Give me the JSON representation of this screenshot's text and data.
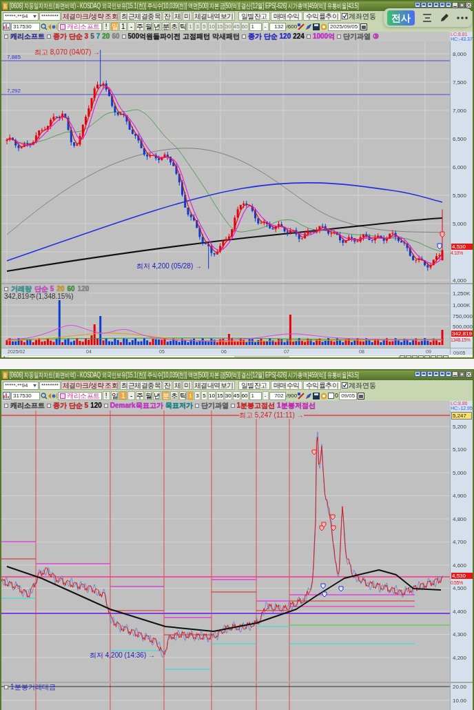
{
  "floating_toolbar": {
    "button": "전사"
  },
  "windows": [
    {
      "kind": "daily",
      "title": "[0606] 자동일자차트(화면비역) - KOSDAQ 외국인보유[15.1(천)] 주식수[10,039(천)] 액면[500] 자본금[50(억)] 결산[12월] EPS[-626] 시가총액[459(억)] 유통비율[43.5]",
      "account": {
        "number": "*****-**94",
        "password": "********",
        "buttons": [
          {
            "label": "체결마크/생략 조회",
            "kind": "mark"
          },
          {
            "label": "최근체결종목",
            "kind": "plain"
          },
          {
            "label": "잔",
            "kind": "plain"
          },
          {
            "label": "체",
            "kind": "plain"
          },
          {
            "label": "미",
            "kind": "plain"
          },
          {
            "label": "체결내역보기",
            "kind": "plain"
          },
          {
            "label": "일별잔고",
            "kind": "wide"
          },
          {
            "label": "매매수익",
            "kind": "wide"
          },
          {
            "label": "수익률추이",
            "kind": "wide"
          }
        ],
        "checkbox": {
          "label": "계좌연동",
          "checked": true
        }
      },
      "symbol": {
        "code": "317530",
        "name": "캐리소프트",
        "alert": "!",
        "periods": [
          {
            "label": "일",
            "selected": true
          },
          {
            "label": "1",
            "selected": false
          },
          {
            "label": "-",
            "selected": false
          },
          {
            "label": "주",
            "selected": false
          },
          {
            "label": "월",
            "selected": false
          },
          {
            "label": "년",
            "selected": false
          },
          {
            "label": "분",
            "selected": false
          },
          {
            "label": "초",
            "selected": false
          },
          {
            "label": "틱",
            "selected": false
          }
        ],
        "intervals": [
          {
            "label": "1",
            "selected": false,
            "disabled": true
          },
          {
            "label": "3",
            "selected": false,
            "disabled": true
          },
          {
            "label": "5",
            "selected": false,
            "disabled": true
          },
          {
            "label": "10",
            "selected": false,
            "disabled": true
          },
          {
            "label": "15",
            "selected": false,
            "disabled": true
          },
          {
            "label": "30",
            "selected": false,
            "disabled": true
          },
          {
            "label": "45",
            "selected": false,
            "disabled": true
          },
          {
            "label": "60",
            "selected": false,
            "disabled": true
          }
        ],
        "count": "1",
        "count_button": "-",
        "shown": "132",
        "total": "/600",
        "date": "2025/09/05"
      },
      "chart": {
        "legend": [
          {
            "items": [
              {
                "text": "캐리소프트",
                "color": "#2a2a9a"
              }
            ]
          },
          {
            "items": [
              {
                "text": "종가 단순 3",
                "color": "#e02020"
              },
              {
                "text": "5",
                "color": "#5c5c5c"
              },
              {
                "text": "7",
                "color": "#00a0a0"
              },
              {
                "text": "20",
                "color": "#30a030"
              },
              {
                "text": "60",
                "color": "#8a8a8a"
              }
            ]
          },
          {
            "items": [
              {
                "text": "500억원돌파이전 고점패턴",
                "color": "#202020"
              },
              {
                "text": "막새패턴",
                "color": "#303030"
              }
            ]
          },
          {
            "items": [
              {
                "text": "종가 단순 120",
                "color": "#2020e0"
              },
              {
                "text": "224",
                "color": "#101010"
              }
            ]
          },
          {
            "items": [
              {
                "text": "1000억",
                "color": "#e020e0"
              }
            ]
          },
          {
            "items": [
              {
                "text": "단기과열",
                "color": "#606060"
              },
              {
                "text": "③",
                "color": "#d020d0"
              }
            ]
          }
        ],
        "lc": "LC:8.81",
        "hc": "HC:-43.37",
        "ticks": [
          "8,000",
          "7,500",
          "7,000",
          "6,500",
          "6,000",
          "5,500",
          "5,000",
          "4,000"
        ],
        "tags": [
          {
            "text": "4,530",
            "kind": "price"
          },
          {
            "text": "4.10%",
            "kind": "change"
          }
        ],
        "annotations": [
          {
            "text": "7,885",
            "kind": "level"
          },
          {
            "text": "7,292",
            "kind": "level"
          },
          {
            "text": "최고 8,070 (04/07) →",
            "kind": "high"
          },
          {
            "text": "최저 4,200 (05/28) →",
            "kind": "low"
          }
        ]
      },
      "volume": {
        "legend": [
          {
            "text": "거래량",
            "color": "#20a0a0"
          },
          {
            "text": "단순 5",
            "color": "#e040e0"
          },
          {
            "text": "20",
            "color": "#e0a000"
          },
          {
            "text": "60",
            "color": "#30a030"
          },
          {
            "text": "120",
            "color": "#8a8a8a"
          }
        ],
        "info": "342,819주(1,348.15%)",
        "ticks": [
          "1,250K",
          "1,000K",
          "750,000",
          "500,000"
        ],
        "tags": [
          {
            "text": "342,819",
            "kind": "price"
          },
          {
            "text": "1348.15%",
            "kind": "change"
          }
        ]
      },
      "x_axis": {
        "labels": [
          "2025/02",
          "04",
          "05",
          "06",
          "07",
          "08",
          "09"
        ],
        "end": "09/05"
      }
    },
    {
      "kind": "minute",
      "title": "[0606] 자동일자차트(화면비역) - KOSDAQ 외국인보유[15.1(천)] 주식수[10,039(천)] 액면[500] 자본금[50(억)] 결산[12월] EPS[-626] 시가총액[459(억)] 유통비율[43.5]",
      "account": {
        "number": "*****-**94",
        "password": "********",
        "buttons": [
          {
            "label": "체결마크/생략 조회",
            "kind": "mark"
          },
          {
            "label": "최근체결종목",
            "kind": "plain"
          },
          {
            "label": "잔",
            "kind": "plain"
          },
          {
            "label": "체",
            "kind": "plain"
          },
          {
            "label": "미",
            "kind": "plain"
          },
          {
            "label": "체결내역보기",
            "kind": "plain"
          },
          {
            "label": "일별잔고",
            "kind": "wide"
          },
          {
            "label": "매매수익",
            "kind": "wide"
          },
          {
            "label": "수익률추이",
            "kind": "wide"
          }
        ],
        "checkbox": {
          "label": "계좌연동",
          "checked": true
        }
      },
      "symbol": {
        "code": "317530",
        "name": "캐리소프트",
        "alert": "!",
        "periods": [
          {
            "label": "일",
            "selected": false
          },
          {
            "label": "1",
            "selected": true
          },
          {
            "label": "-",
            "selected": false
          },
          {
            "label": "주",
            "selected": false
          },
          {
            "label": "월",
            "selected": false
          },
          {
            "label": "년",
            "selected": false
          },
          {
            "label": "분",
            "selected": true
          },
          {
            "label": "초",
            "selected": false
          },
          {
            "label": "틱",
            "selected": false
          }
        ],
        "intervals": [
          {
            "label": "1",
            "selected": true,
            "disabled": false
          },
          {
            "label": "3",
            "selected": false,
            "disabled": false
          },
          {
            "label": "5",
            "selected": false,
            "disabled": false
          },
          {
            "label": "10",
            "selected": false,
            "disabled": false
          },
          {
            "label": "15",
            "selected": false,
            "disabled": false
          },
          {
            "label": "30",
            "selected": false,
            "disabled": false
          },
          {
            "label": "45",
            "selected": false,
            "disabled": false
          },
          {
            "label": "60",
            "selected": false,
            "disabled": false
          }
        ],
        "count": "1",
        "count_button": "-",
        "shown": "702",
        "total": "/900",
        "date_check": {
          "label": "0",
          "checked": false
        },
        "date": "09/05"
      },
      "chart": {
        "legend": [
          {
            "items": [
              {
                "text": "캐리소프트",
                "color": "#404040"
              }
            ]
          },
          {
            "items": [
              {
                "text": "종가 단순 5",
                "color": "#e02020"
              },
              {
                "text": "120",
                "color": "#101010"
              }
            ]
          },
          {
            "items": [
              {
                "text": "Demark목표고가",
                "color": "#e020e0"
              },
              {
                "text": "목표저가",
                "color": "#008c8c"
              }
            ]
          },
          {
            "items": [
              {
                "text": "단기과열",
                "color": "#5e5e5e"
              }
            ]
          },
          {
            "items": [
              {
                "text": "1분봉고점선",
                "color": "#e81818"
              },
              {
                "text": "1분봉저점선",
                "color": "#e018c8"
              }
            ]
          }
        ],
        "lc": "LC:8.86",
        "hc": "HC:-12.95",
        "ticks": [
          "5,200",
          "5,100",
          "5,000",
          "4,900",
          "4,800",
          "4,700",
          "4,600",
          "4,500",
          "4,400",
          "4,300",
          "4,200"
        ],
        "tags": [
          {
            "text": "5,247",
            "kind": "high"
          },
          {
            "text": "4,530",
            "kind": "price"
          },
          {
            "text": "0.55%",
            "kind": "change"
          }
        ],
        "annotations": [
          {
            "text": "최고 5,247 (11:11) →",
            "kind": "high"
          },
          {
            "text": "최저 4,200 (14:36) →",
            "kind": "low"
          }
        ]
      },
      "lower_panel": {
        "label": "1분봉거래대금",
        "ticks": [
          "20.00",
          "10.00"
        ]
      }
    }
  ]
}
